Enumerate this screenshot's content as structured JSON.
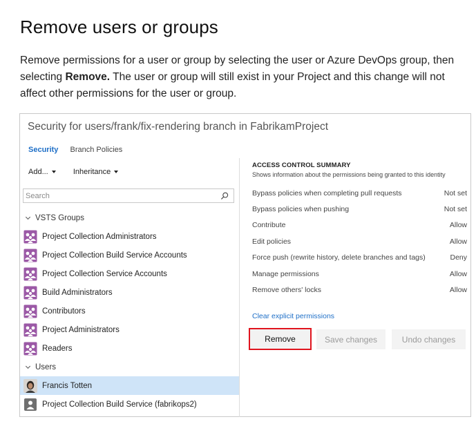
{
  "article": {
    "title": "Remove users or groups",
    "para_before": "Remove permissions for a user or group by selecting the user or Azure DevOps group, then selecting ",
    "para_bold": "Remove.",
    "para_after": " The user or group will still exist in your Project and this change will not affect other permissions for the user or group."
  },
  "dialog": {
    "title": "Security for users/frank/fix-rendering branch in FabrikamProject",
    "tabs": [
      {
        "label": "Security",
        "active": true
      },
      {
        "label": "Branch Policies",
        "active": false
      }
    ],
    "toolbar": {
      "add_label": "Add...",
      "inheritance_label": "Inheritance"
    },
    "search": {
      "placeholder": "Search"
    },
    "groups_header": "VSTS Groups",
    "groups": [
      "Project Collection Administrators",
      "Project Collection Build Service Accounts",
      "Project Collection Service Accounts",
      "Build Administrators",
      "Contributors",
      "Project Administrators",
      "Readers"
    ],
    "users_header": "Users",
    "users": [
      {
        "name": "Francis Totten",
        "selected": true,
        "icon": "user-avatar-photo"
      },
      {
        "name": "Project Collection Build Service (fabrikops2)",
        "selected": false,
        "icon": "service-account-icon"
      }
    ],
    "acs": {
      "title": "ACCESS CONTROL SUMMARY",
      "subtitle": "Shows information about the permissions being granted to this identity",
      "permissions": [
        {
          "name": "Bypass policies when completing pull requests",
          "value": "Not set"
        },
        {
          "name": "Bypass policies when pushing",
          "value": "Not set"
        },
        {
          "name": "Contribute",
          "value": "Allow"
        },
        {
          "name": "Edit policies",
          "value": "Allow"
        },
        {
          "name": "Force push (rewrite history, delete branches and tags)",
          "value": "Deny"
        },
        {
          "name": "Manage permissions",
          "value": "Allow"
        },
        {
          "name": "Remove others' locks",
          "value": "Allow"
        }
      ]
    },
    "clear_link": "Clear explicit permissions",
    "buttons": {
      "remove": "Remove",
      "save": "Save changes",
      "undo": "Undo changes"
    },
    "colors": {
      "accent": "#1e6fc7",
      "selected_row": "#cfe4f8",
      "highlight_border": "#e0141e",
      "group_icon": "#9b59a6"
    }
  }
}
